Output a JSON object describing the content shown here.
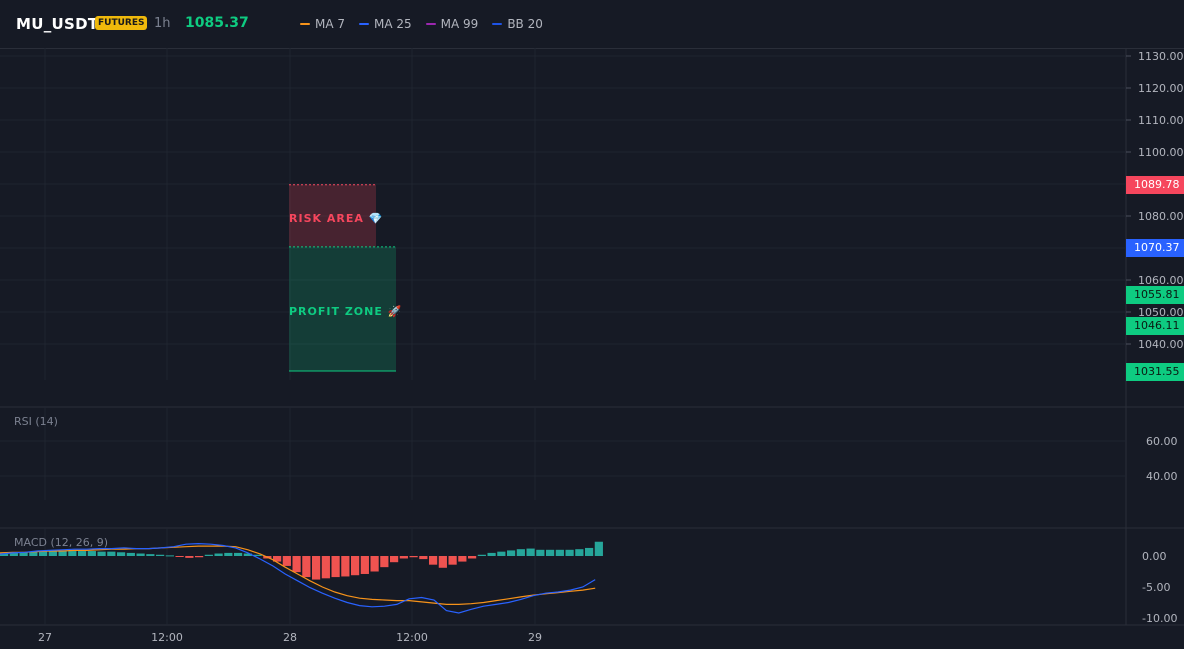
{
  "header": {
    "symbol": "MU_USDT",
    "badge": "FUTURES",
    "timeframe": "1h",
    "last_price": "1085.37",
    "legend": [
      {
        "label": "MA 7",
        "color": "#f7931a"
      },
      {
        "label": "MA 25",
        "color": "#2962ff"
      },
      {
        "label": "MA 99",
        "color": "#9c27b0"
      },
      {
        "label": "BB 20",
        "color": "#1e53e5"
      }
    ]
  },
  "price_axis": {
    "ticks": [
      "1130.00",
      "1120.00",
      "1110.00",
      "1100.00",
      "1080.00",
      "1060.00",
      "1050.00",
      "1040.00"
    ],
    "tags": [
      {
        "label": "1089.78",
        "color": "#f6465d"
      },
      {
        "label": "1070.37",
        "color": "#2962ff"
      },
      {
        "label": "1055.81",
        "color": "#0ecb81"
      },
      {
        "label": "1046.11",
        "color": "#0ecb81"
      },
      {
        "label": "1031.55",
        "color": "#0ecb81"
      }
    ]
  },
  "zones": {
    "risk_label": "RISK AREA 💎",
    "profit_label": "PROFIT ZONE 🚀",
    "stop_price": 1089.78,
    "entry_price": 1070.37,
    "target_price": 1031.55
  },
  "rsi": {
    "label": "RSI (14)",
    "ticks": [
      "60.00",
      "40.00"
    ]
  },
  "macd": {
    "label": "MACD (12, 26, 9)",
    "ticks": [
      "0.00",
      "-5.00",
      "-10.00"
    ],
    "histogram": [
      0.4,
      0.5,
      0.6,
      0.7,
      0.8,
      0.8,
      0.9,
      0.8,
      0.8,
      0.8,
      0.7,
      0.7,
      0.6,
      0.5,
      0.4,
      0.3,
      0.2,
      0.1,
      -0.1,
      -0.3,
      -0.2,
      0.2,
      0.4,
      0.5,
      0.5,
      0.4,
      0.2,
      -0.4,
      -0.9,
      -1.6,
      -2.6,
      -3.4,
      -3.8,
      -3.6,
      -3.4,
      -3.3,
      -3.1,
      -2.9,
      -2.5,
      -1.8,
      -1.0,
      -0.4,
      -0.2,
      -0.5,
      -1.4,
      -1.9,
      -1.4,
      -0.9,
      -0.4,
      0.2,
      0.5,
      0.7,
      0.9,
      1.1,
      1.2,
      1.0,
      1.0,
      1.0,
      1.0,
      1.1,
      1.3,
      2.3
    ],
    "macd_line": [
      0.3,
      0.5,
      0.6,
      0.8,
      0.9,
      1.0,
      1.1,
      1.1,
      1.2,
      1.2,
      1.3,
      1.2,
      1.2,
      1.3,
      1.5,
      1.9,
      2.0,
      1.9,
      1.7,
      1.3,
      0.5,
      -0.5,
      -1.6,
      -2.9,
      -4.0,
      -5.1,
      -6.0,
      -6.8,
      -7.5,
      -8.0,
      -8.2,
      -8.1,
      -7.8,
      -6.9,
      -6.7,
      -7.1,
      -8.8,
      -9.2,
      -8.6,
      -8.1,
      -7.8,
      -7.5,
      -7.0,
      -6.4,
      -6.0,
      -5.8,
      -5.5,
      -5.0,
      -3.8
    ],
    "signal_line": [
      0.5,
      0.6,
      0.6,
      0.7,
      0.8,
      0.8,
      0.9,
      0.9,
      1.0,
      1.1,
      1.1,
      1.2,
      1.2,
      1.3,
      1.4,
      1.5,
      1.6,
      1.6,
      1.6,
      1.5,
      1.0,
      0.3,
      -0.6,
      -1.8,
      -2.9,
      -4.0,
      -5.0,
      -5.8,
      -6.4,
      -6.8,
      -7.0,
      -7.1,
      -7.2,
      -7.2,
      -7.4,
      -7.6,
      -7.8,
      -7.8,
      -7.7,
      -7.5,
      -7.2,
      -6.9,
      -6.6,
      -6.3,
      -6.1,
      -5.9,
      -5.7,
      -5.5,
      -5.2
    ]
  },
  "time_axis": {
    "labels": [
      "27",
      "12:00",
      "28",
      "12:00",
      "29"
    ]
  }
}
